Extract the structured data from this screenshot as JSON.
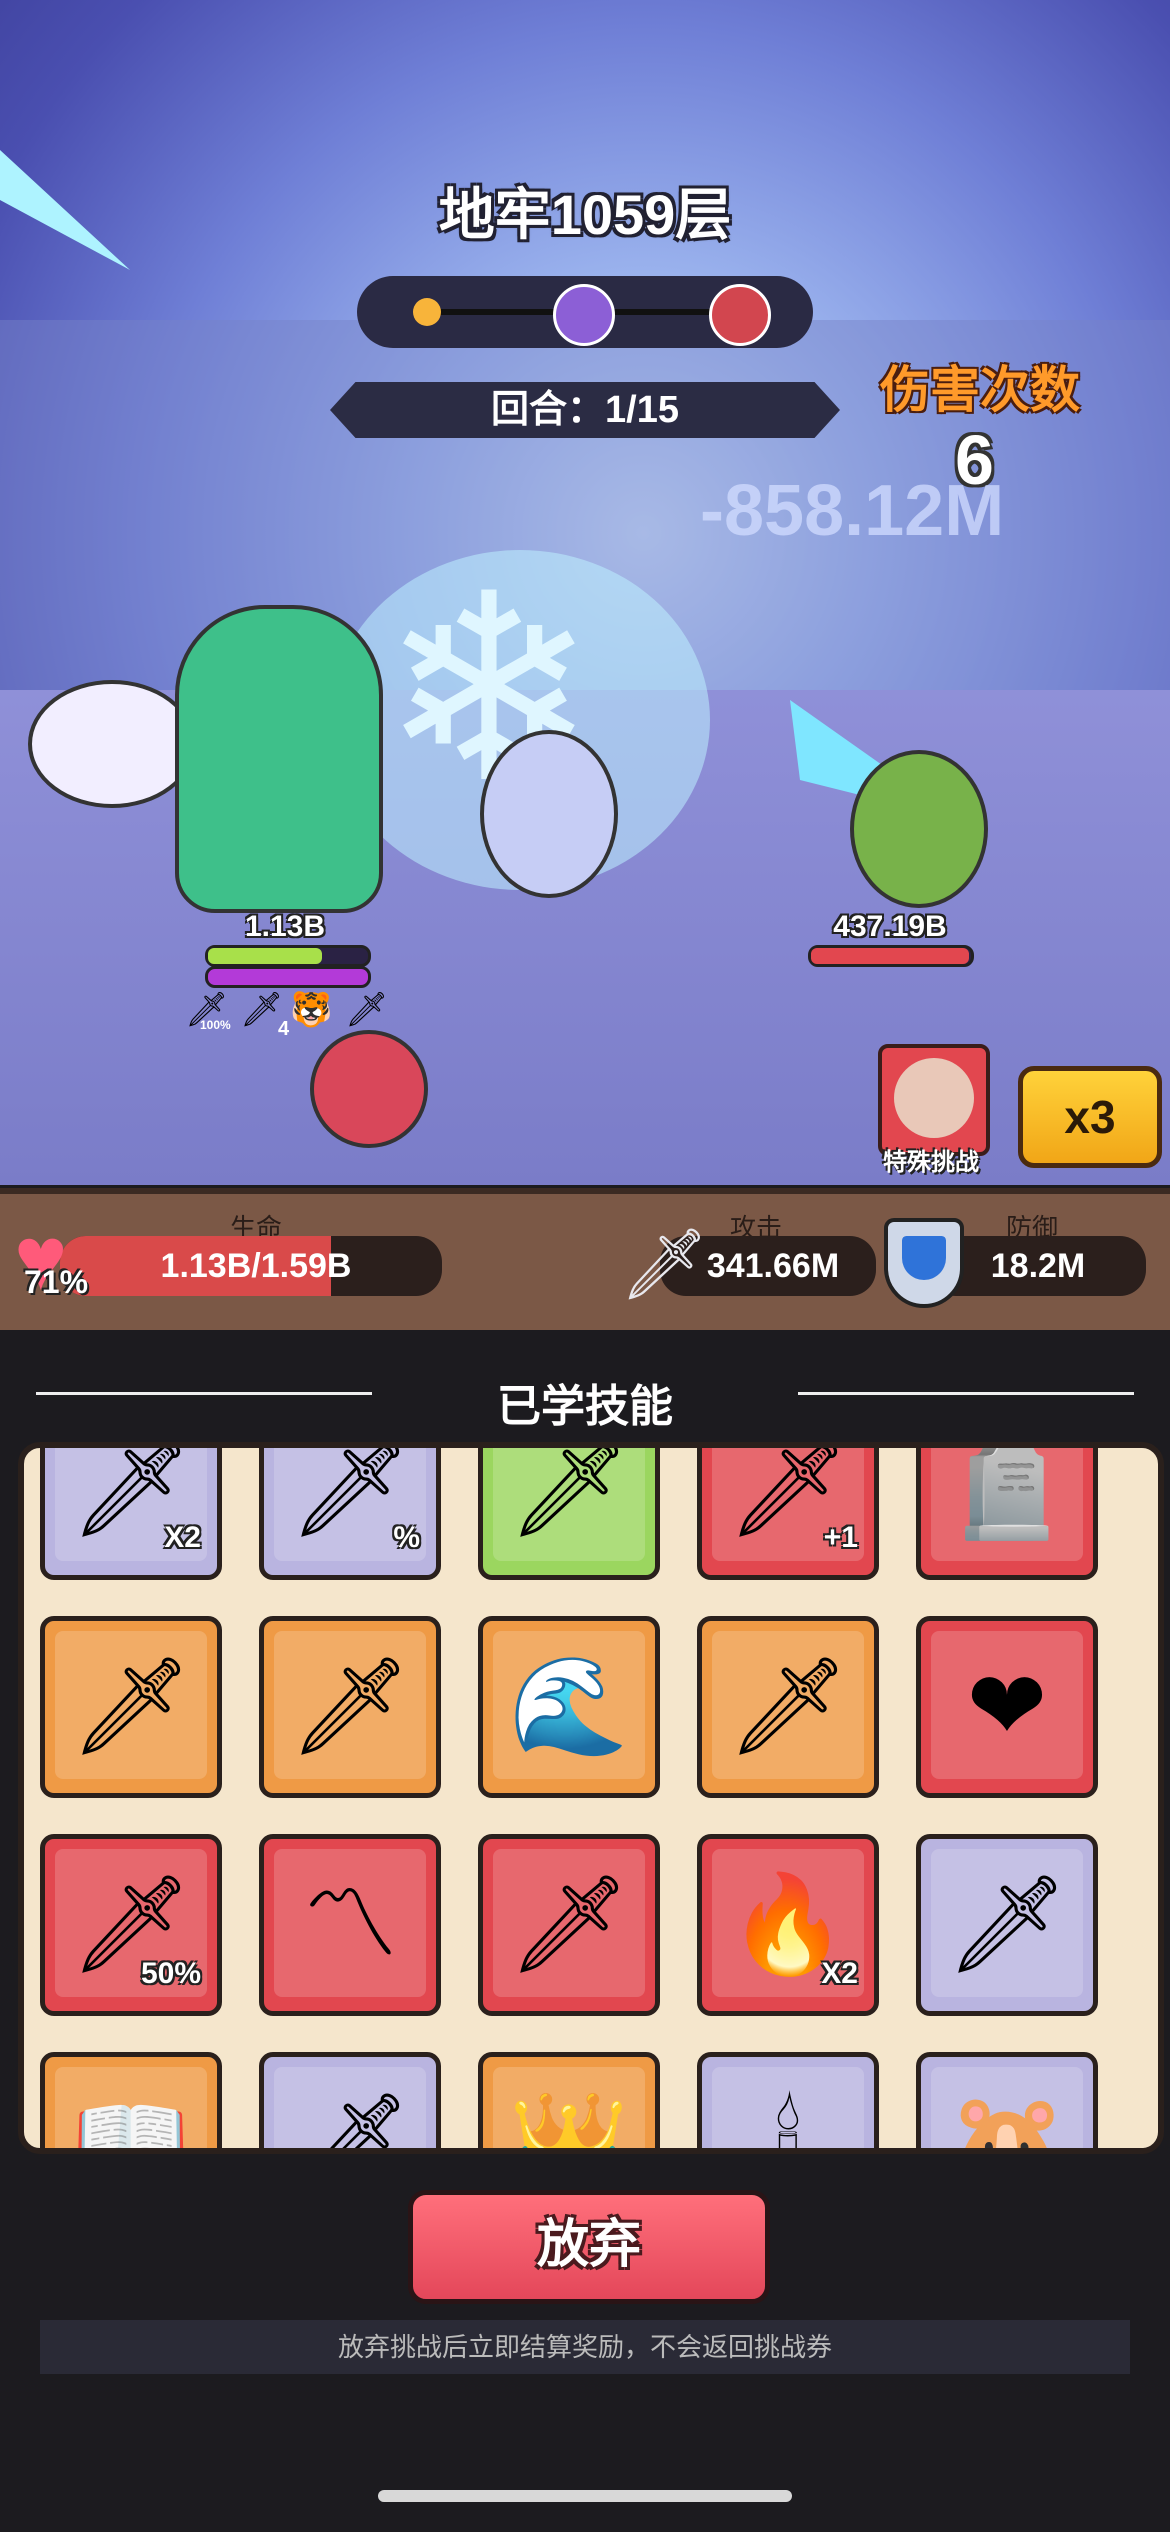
{
  "battle": {
    "title": "地牢1059层",
    "round": "回合：1/15",
    "damage_label": "伤害次数",
    "damage_count": "6",
    "damage_number": "-858.12M",
    "player_hp": "1.13B",
    "enemy_hp": "437.19B",
    "player_buff_1": "100%",
    "player_buff_2": "4",
    "player_hp_fraction": 0.71,
    "enemy_hp_fraction": 0.99,
    "special_challenge": "特殊挑战",
    "speed": "x3"
  },
  "stats": {
    "hp_title": "生命",
    "hp_percent": "71%",
    "hp_value": "1.13B/1.59B",
    "hp_fraction": 0.71,
    "atk_title": "攻击",
    "atk_value": "341.66M",
    "def_title": "防御",
    "def_value": "18.2M"
  },
  "skills": {
    "title": "已学技能",
    "tiles": [
      {
        "color": "purple",
        "icon": "sword",
        "badge": "X2"
      },
      {
        "color": "purple",
        "icon": "sword",
        "badge": "%"
      },
      {
        "color": "green",
        "icon": "sword",
        "badge": ""
      },
      {
        "color": "red",
        "icon": "sword",
        "badge": "+1"
      },
      {
        "color": "red",
        "icon": "tombstone",
        "badge": ""
      },
      {
        "color": "orange",
        "icon": "sword",
        "badge": ""
      },
      {
        "color": "orange",
        "icon": "sword",
        "badge": ""
      },
      {
        "color": "orange",
        "icon": "wave",
        "badge": ""
      },
      {
        "color": "orange",
        "icon": "sword",
        "badge": ""
      },
      {
        "color": "red",
        "icon": "heart",
        "badge": ""
      },
      {
        "color": "red",
        "icon": "sword",
        "badge": "50%"
      },
      {
        "color": "red",
        "icon": "slash",
        "badge": ""
      },
      {
        "color": "red",
        "icon": "sword",
        "badge": ""
      },
      {
        "color": "red",
        "icon": "fire",
        "badge": "X2"
      },
      {
        "color": "purple",
        "icon": "sword",
        "badge": ""
      },
      {
        "color": "orange",
        "icon": "book",
        "badge": ""
      },
      {
        "color": "purple",
        "icon": "sword",
        "badge": ""
      },
      {
        "color": "orange",
        "icon": "crown",
        "badge": ""
      },
      {
        "color": "purple",
        "icon": "pillar",
        "badge": ""
      },
      {
        "color": "purple",
        "icon": "capybara",
        "badge": ""
      }
    ]
  },
  "give_up": "放弃",
  "notice": "放弃挑战后立即结算奖励，不会返回挑战券",
  "colors": {
    "purple": "#b9b4e0",
    "green": "#9bd65f",
    "red": "#e2474f",
    "orange": "#ef9a45"
  }
}
